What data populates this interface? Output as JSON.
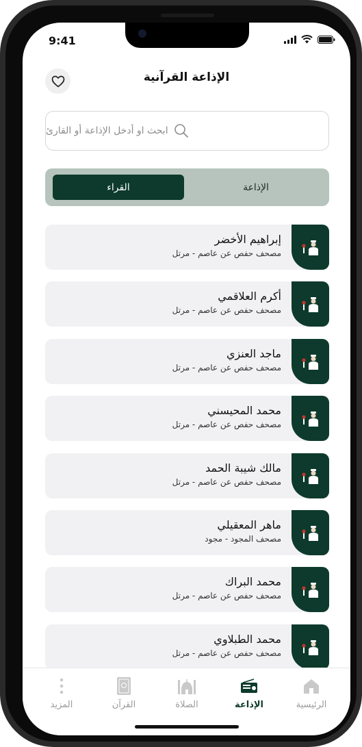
{
  "status": {
    "time": "9:41"
  },
  "header": {
    "title": "الإذاعة القرآنية"
  },
  "search": {
    "placeholder": "ابحث او أدخل الإذاعة أو القارئ"
  },
  "segments": {
    "radio": "الإذاعة",
    "readers": "القراء",
    "selected": "readers"
  },
  "readers": [
    {
      "name": "إبراهيم الأخضر",
      "mushaf": "مصحف حفص عن عاصم - مرتل"
    },
    {
      "name": "أكرم العلاقمي",
      "mushaf": "مصحف حفص عن عاصم - مرتل"
    },
    {
      "name": "ماجد العنزي",
      "mushaf": "مصحف حفص عن عاصم - مرتل"
    },
    {
      "name": "محمد المحيسني",
      "mushaf": "مصحف حفص عن عاصم - مرتل"
    },
    {
      "name": "مالك شيبة الحمد",
      "mushaf": "مصحف حفص عن عاصم - مرتل"
    },
    {
      "name": "ماهر المعقيلي",
      "mushaf": "مصحف المجود - مجود"
    },
    {
      "name": "محمد البراك",
      "mushaf": "مصحف حفص عن عاصم - مرتل"
    },
    {
      "name": "محمد الطبلاوي",
      "mushaf": "مصحف حفص عن عاصم - مرتل"
    }
  ],
  "tabbar": {
    "home": {
      "label": "الرئيسية",
      "icon": "home-icon"
    },
    "radio": {
      "label": "الإذاعة",
      "icon": "radio-icon"
    },
    "prayer": {
      "label": "الصلاة",
      "icon": "mosque-icon"
    },
    "quran": {
      "label": "القرآن",
      "icon": "quran-book-icon"
    },
    "more": {
      "label": "المزيد",
      "icon": "more-dots-icon"
    },
    "active": "radio"
  },
  "colors": {
    "primary": "#0d3a2c",
    "segment_bg": "#b6c4bd",
    "card_bg": "#f1f1f3"
  }
}
